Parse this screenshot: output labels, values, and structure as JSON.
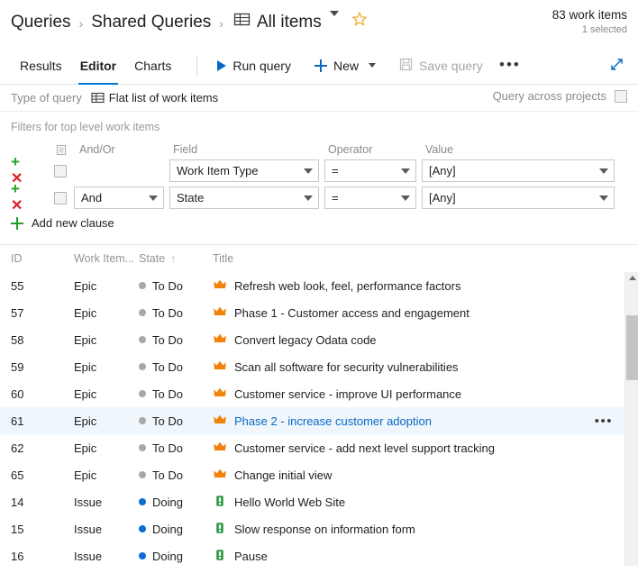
{
  "breadcrumb": {
    "root": "Queries",
    "folder": "Shared Queries",
    "current": "All items",
    "separator": "›",
    "grid_icon": "table-grid-icon",
    "chevron_icon": "chevron-down-icon",
    "star_icon": "favorite-star-icon"
  },
  "status": {
    "count": "83 work items",
    "selected": "1 selected"
  },
  "tabs": [
    {
      "label": "Results",
      "active": false
    },
    {
      "label": "Editor",
      "active": true
    },
    {
      "label": "Charts",
      "active": false
    }
  ],
  "toolbar": {
    "run_query": "Run query",
    "new": "New",
    "save_query": "Save query",
    "more": "•••",
    "run_icon": "play-triangle-icon",
    "new_icon": "plus-icon",
    "save_icon": "save-disk-icon",
    "more_icon": "ellipsis-icon",
    "expand_icon": "expand-diagonal-icon"
  },
  "query_type": {
    "label": "Type of query",
    "value": "Flat list of work items",
    "icon": "table-grid-icon",
    "across_projects_label": "Query across projects",
    "across_projects_checked": false
  },
  "filters": {
    "title": "Filters for top level work items",
    "headers": {
      "andor": "And/Or",
      "field": "Field",
      "operator": "Operator",
      "value": "Value",
      "list_icon": "list-lines-icon"
    },
    "rows": [
      {
        "andor": "",
        "field": "Work Item Type",
        "operator": "=",
        "value": "[Any]",
        "checked": false
      },
      {
        "andor": "And",
        "field": "State",
        "operator": "=",
        "value": "[Any]",
        "checked": false
      }
    ],
    "add_clause": "Add new clause"
  },
  "grid": {
    "columns": {
      "id": "ID",
      "type": "Work Item...",
      "state": "State",
      "title": "Title",
      "sort_indicator": "↑"
    },
    "rows": [
      {
        "id": "55",
        "type": "Epic",
        "state": "To Do",
        "state_color": "#a8a8a8",
        "title": "Refresh web look, feel, performance factors",
        "icon": "epic-crown-icon",
        "selected": false
      },
      {
        "id": "57",
        "type": "Epic",
        "state": "To Do",
        "state_color": "#a8a8a8",
        "title": "Phase 1 - Customer access and engagement",
        "icon": "epic-crown-icon",
        "selected": false
      },
      {
        "id": "58",
        "type": "Epic",
        "state": "To Do",
        "state_color": "#a8a8a8",
        "title": "Convert legacy Odata code",
        "icon": "epic-crown-icon",
        "selected": false
      },
      {
        "id": "59",
        "type": "Epic",
        "state": "To Do",
        "state_color": "#a8a8a8",
        "title": "Scan all software for security vulnerabilities",
        "icon": "epic-crown-icon",
        "selected": false
      },
      {
        "id": "60",
        "type": "Epic",
        "state": "To Do",
        "state_color": "#a8a8a8",
        "title": "Customer service - improve UI performance",
        "icon": "epic-crown-icon",
        "selected": false
      },
      {
        "id": "61",
        "type": "Epic",
        "state": "To Do",
        "state_color": "#a8a8a8",
        "title": "Phase 2 - increase customer adoption",
        "icon": "epic-crown-icon",
        "selected": true,
        "row_menu": "•••"
      },
      {
        "id": "62",
        "type": "Epic",
        "state": "To Do",
        "state_color": "#a8a8a8",
        "title": "Customer service - add next level support tracking",
        "icon": "epic-crown-icon",
        "selected": false
      },
      {
        "id": "65",
        "type": "Epic",
        "state": "To Do",
        "state_color": "#a8a8a8",
        "title": "Change initial view",
        "icon": "epic-crown-icon",
        "selected": false
      },
      {
        "id": "14",
        "type": "Issue",
        "state": "Doing",
        "state_color": "#0a6cd4",
        "title": "Hello World Web Site",
        "icon": "issue-green-icon",
        "selected": false
      },
      {
        "id": "15",
        "type": "Issue",
        "state": "Doing",
        "state_color": "#0a6cd4",
        "title": "Slow response on information form",
        "icon": "issue-green-icon",
        "selected": false
      },
      {
        "id": "16",
        "type": "Issue",
        "state": "Doing",
        "state_color": "#0a6cd4",
        "title": "Pause",
        "icon": "issue-green-icon",
        "selected": false
      }
    ]
  },
  "colors": {
    "accent": "#0078d4",
    "epic_orange": "#f2820a",
    "issue_green": "#339947",
    "add_green": "#22a02a",
    "remove_red": "#e01b24",
    "star_amber": "#f2b33d",
    "selected_row": "#eff6fc"
  }
}
